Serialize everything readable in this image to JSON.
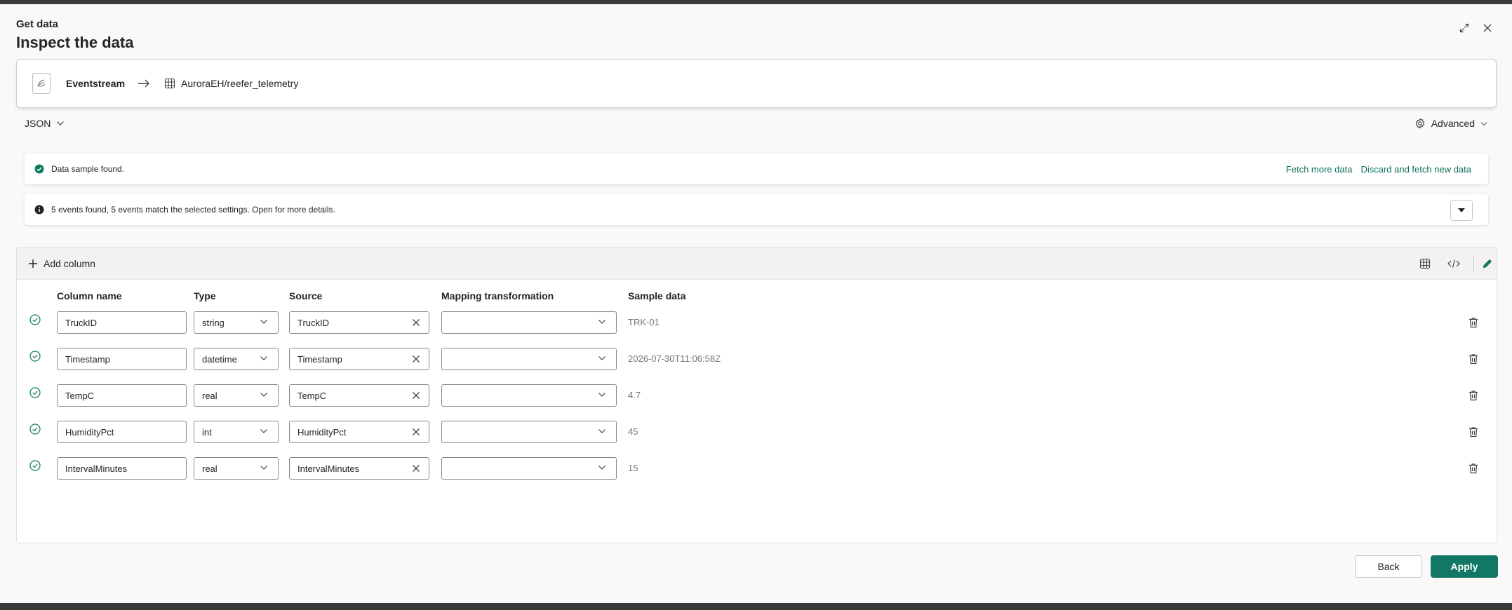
{
  "header": {
    "subtitle": "Get data",
    "title": "Inspect the data"
  },
  "pipeline": {
    "source": "Eventstream",
    "destination": "AuroraEH/reefer_telemetry"
  },
  "format": {
    "selected": "JSON"
  },
  "advanced": {
    "label": "Advanced"
  },
  "banners": {
    "sample": {
      "text": "Data sample found.",
      "fetch_more": "Fetch more data",
      "discard_fetch": "Discard and fetch new data"
    },
    "events": {
      "text": "5 events found, 5 events match the selected settings. Open for more details."
    }
  },
  "toolbar": {
    "add_column": "Add column"
  },
  "table": {
    "headers": {
      "column_name": "Column name",
      "type": "Type",
      "source": "Source",
      "mapping": "Mapping transformation",
      "sample": "Sample data"
    },
    "rows": [
      {
        "name": "TruckID",
        "type": "string",
        "source": "TruckID",
        "mapping": "",
        "sample": "TRK-01"
      },
      {
        "name": "Timestamp",
        "type": "datetime",
        "source": "Timestamp",
        "mapping": "",
        "sample": "2026-07-30T11:06:58Z"
      },
      {
        "name": "TempC",
        "type": "real",
        "source": "TempC",
        "mapping": "",
        "sample": "4.7"
      },
      {
        "name": "HumidityPct",
        "type": "int",
        "source": "HumidityPct",
        "mapping": "",
        "sample": "45"
      },
      {
        "name": "IntervalMinutes",
        "type": "real",
        "source": "IntervalMinutes",
        "mapping": "",
        "sample": "15"
      }
    ]
  },
  "footer": {
    "back": "Back",
    "apply": "Apply"
  },
  "colors": {
    "accent": "#117865",
    "link": "#0f6f5c",
    "success": "#0e7a5f"
  }
}
